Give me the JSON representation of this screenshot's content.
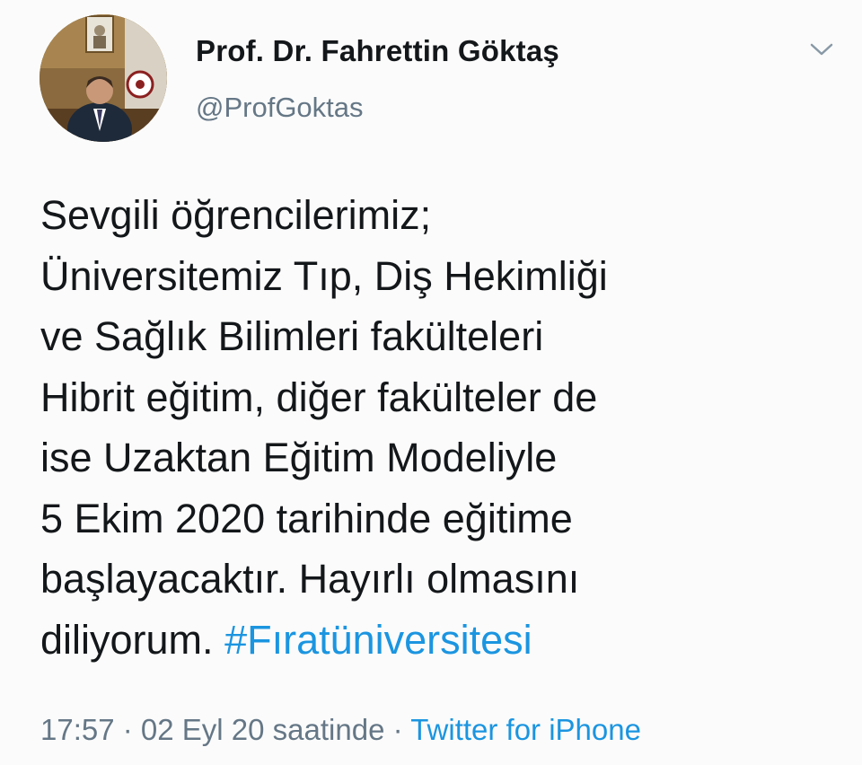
{
  "author": {
    "display_name": "Prof. Dr. Fahrettin Göktaş",
    "handle": "@ProfGoktas"
  },
  "tweet": {
    "lines": [
      "Sevgili öğrencilerimiz;",
      "Üniversitemiz Tıp, Diş Hekimliği",
      "ve Sağlık Bilimleri fakülteleri",
      "Hibrit eğitim, diğer fakülteler de",
      "ise Uzaktan Eğitim Modeliyle",
      "5 Ekim 2020 tarihinde eğitime",
      "başlayacaktır. Hayırlı olmasını",
      "diliyorum."
    ],
    "hashtag": "#Fıratüniversitesi"
  },
  "meta": {
    "time": "17:57",
    "separator": " · ",
    "date_text": "02 Eyl 20 saatinde",
    "source": "Twitter for iPhone"
  },
  "icons": {
    "menu": "chevron-down-icon"
  },
  "colors": {
    "link": "#1b95e0",
    "secondary_text": "#657786",
    "primary_text": "#14171a"
  }
}
